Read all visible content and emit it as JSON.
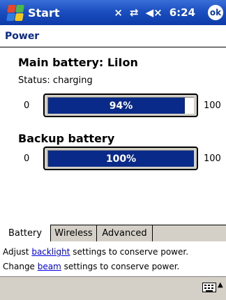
{
  "titlebar": {
    "title": "Start",
    "icons": [
      "connectivity-off-icon",
      "sync-icon",
      "speaker-muted-icon"
    ],
    "time": "6:24",
    "ok_label": "ok"
  },
  "header": {
    "title": "Power"
  },
  "main_battery": {
    "title": "Main battery: LiIon",
    "status": "Status: charging",
    "min": "0",
    "max": "100",
    "percent_text": "94%",
    "level": 0.94
  },
  "backup_battery": {
    "title": "Backup battery",
    "min": "0",
    "max": "100",
    "percent_text": "100%",
    "level": 1.0
  },
  "tabs": [
    {
      "label": "Battery",
      "active": true
    },
    {
      "label": "Wireless",
      "active": false
    },
    {
      "label": "Advanced",
      "active": false
    }
  ],
  "hints": {
    "line1_pre": "Adjust ",
    "line1_link": "backlight",
    "line1_post": " settings to conserve power.",
    "line2_pre": "Change ",
    "line2_link": "beam",
    "line2_post": " settings to conserve power."
  },
  "colors": {
    "titlebar": "#1b4fc0",
    "bar_fill": "#0a2a8a",
    "header_text": "#0a2a8a"
  }
}
